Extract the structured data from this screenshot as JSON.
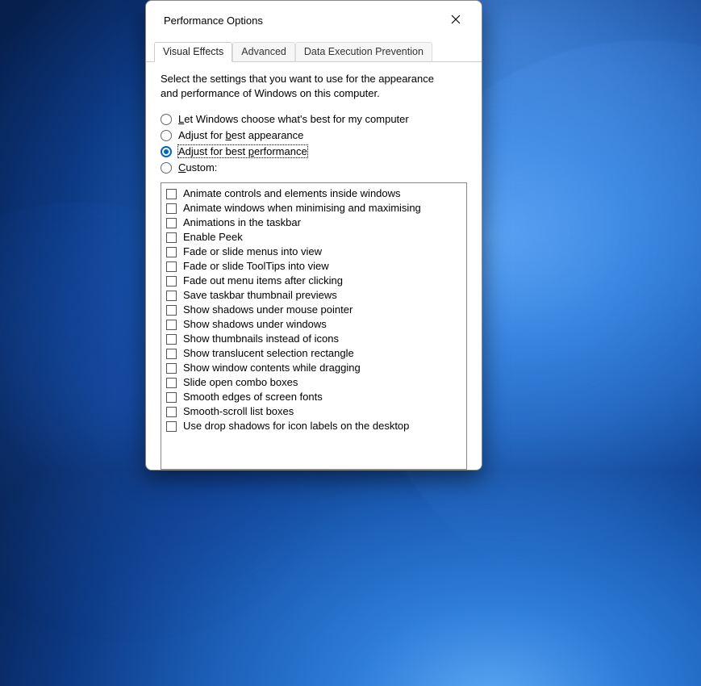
{
  "dialog": {
    "title": "Performance Options",
    "tabs": [
      {
        "label": "Visual Effects",
        "active": true
      },
      {
        "label": "Advanced",
        "active": false
      },
      {
        "label": "Data Execution Prevention",
        "active": false
      }
    ],
    "intro": "Select the settings that you want to use for the appearance and performance of Windows on this computer.",
    "radios": [
      {
        "label_pre": "",
        "accel": "L",
        "label_post": "et Windows choose what's best for my computer",
        "selected": false
      },
      {
        "label_pre": "Adjust for ",
        "accel": "b",
        "label_post": "est appearance",
        "selected": false
      },
      {
        "label_pre": "Adjust for best ",
        "accel": "p",
        "label_post": "erformance",
        "selected": true,
        "focused": true
      },
      {
        "label_pre": "",
        "accel": "C",
        "label_post": "ustom:",
        "selected": false
      }
    ],
    "checklist": [
      {
        "label": "Animate controls and elements inside windows",
        "checked": false
      },
      {
        "label": "Animate windows when minimising and maximising",
        "checked": false
      },
      {
        "label": "Animations in the taskbar",
        "checked": false
      },
      {
        "label": "Enable Peek",
        "checked": false
      },
      {
        "label": "Fade or slide menus into view",
        "checked": false
      },
      {
        "label": "Fade or slide ToolTips into view",
        "checked": false
      },
      {
        "label": "Fade out menu items after clicking",
        "checked": false
      },
      {
        "label": "Save taskbar thumbnail previews",
        "checked": false
      },
      {
        "label": "Show shadows under mouse pointer",
        "checked": false
      },
      {
        "label": "Show shadows under windows",
        "checked": false
      },
      {
        "label": "Show thumbnails instead of icons",
        "checked": false
      },
      {
        "label": "Show translucent selection rectangle",
        "checked": false
      },
      {
        "label": "Show window contents while dragging",
        "checked": false
      },
      {
        "label": "Slide open combo boxes",
        "checked": false
      },
      {
        "label": "Smooth edges of screen fonts",
        "checked": false
      },
      {
        "label": "Smooth-scroll list boxes",
        "checked": false
      },
      {
        "label": "Use drop shadows for icon labels on the desktop",
        "checked": false
      }
    ]
  }
}
